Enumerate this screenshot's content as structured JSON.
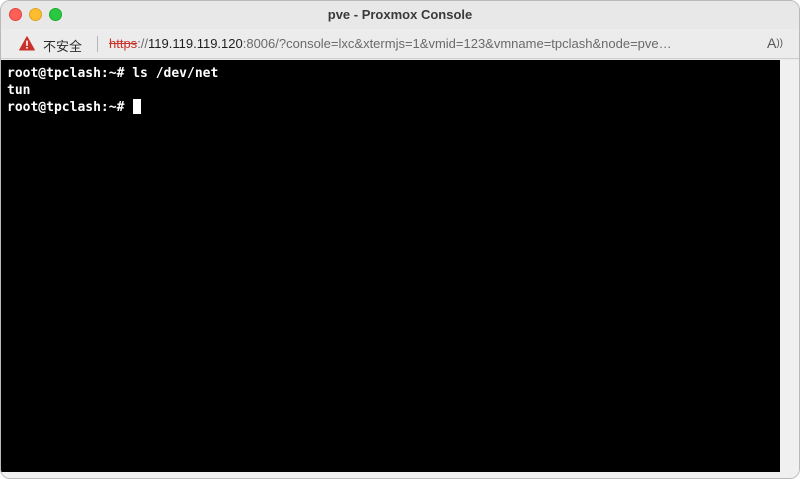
{
  "window": {
    "title": "pve - Proxmox Console"
  },
  "address_bar": {
    "security_label": "不安全",
    "url_scheme": "https",
    "url_sep": "://",
    "url_host": "119.119.119.120",
    "url_rest": ":8006/?console=lxc&xtermjs=1&vmid=123&vmname=tpclash&node=pve…",
    "reader_icon": "Aᐧ"
  },
  "terminal": {
    "lines": [
      "root@tpclash:~# ls /dev/net",
      "tun",
      "root@tpclash:~# "
    ]
  },
  "colors": {
    "terminal_bg": "#000000",
    "terminal_fg": "#ffffff",
    "insecure_red": "#c8322a"
  },
  "icons": {
    "warning": "warning-triangle-icon",
    "reader": "reader-mode-icon"
  }
}
